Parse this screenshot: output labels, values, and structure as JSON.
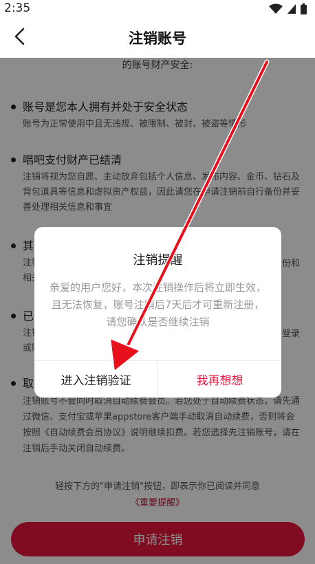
{
  "status_bar": {
    "time": "2:35"
  },
  "nav": {
    "title": "注销账号"
  },
  "intro": "的账号财产安全:",
  "sections": [
    {
      "title": "账号是您本人拥有并处于安全状态",
      "desc": "账号为正常使用中且无违规、被限制、被封、被盗等情形"
    },
    {
      "title": "唱吧支付财产已结清",
      "desc": "注销将视为您自愿、主动放弃包括个人信息、发布内容、金币、钻石及背包道具等信息和虚拟资产权益，因此请您在申请注销前自行备份并妥善处理相关信息和事宜"
    },
    {
      "title": "其",
      "desc": "注销\n相关"
    },
    {
      "title": "已",
      "desc": "注销\n或账"
    },
    {
      "title": "取",
      "desc": "注销账号不会同时取消自动续费会员。若您处于自动续费状态，请先通过微信、支付宝或苹果appstore客户端手动取消自动续费，否则将会按照《自动续费会员协议》说明继续扣费。若您选择先注销账号，请在注销后手动关闭自动续费。"
    }
  ],
  "partial_right": {
    "line1": "份和",
    "line2": "登录"
  },
  "footer": {
    "note": "轻按下方的\"申请注销\"按钮，即表示你已阅读并同意",
    "link": "《重要提醒》",
    "apply_button": "申请注销"
  },
  "dialog": {
    "title": "注销提醒",
    "message": "亲爱的用户您好，本次注销操作后将立即生效，且无法恢复，账号注销后7天后才可重新注册，请您确认是否继续注销",
    "confirm_button": "进入注销验证",
    "cancel_button": "我再想想"
  },
  "colors": {
    "accent": "#e8163c",
    "overlay": "rgba(0,0,0,0.45)",
    "annotation_arrow": "#e8101c"
  },
  "icons": [
    "wifi-icon",
    "signal-icon",
    "battery-icon",
    "back-arrow-icon"
  ]
}
